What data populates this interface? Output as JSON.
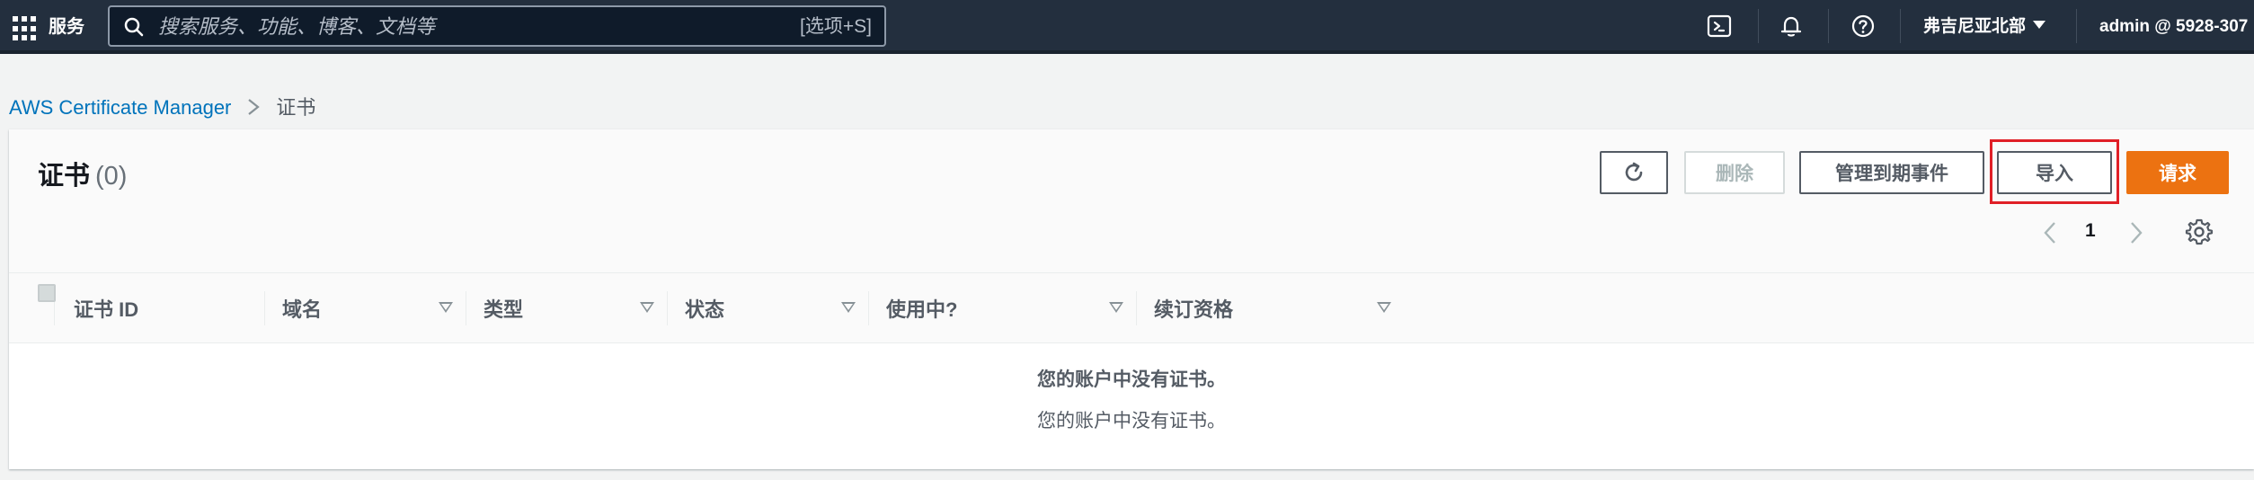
{
  "topnav": {
    "services_label": "服务",
    "search_placeholder": "搜索服务、功能、博客、文档等",
    "search_shortcut": "[选项+S]",
    "region": "弗吉尼亚北部",
    "account": "admin @ 5928-307"
  },
  "breadcrumb": {
    "root": "AWS Certificate Manager",
    "current": "证书"
  },
  "panel": {
    "title": "证书",
    "count": "(0)",
    "buttons": {
      "delete": "删除",
      "manage_expiry": "管理到期事件",
      "import": "导入",
      "request": "请求"
    },
    "page_number": "1"
  },
  "table": {
    "columns": [
      "证书 ID",
      "域名",
      "类型",
      "状态",
      "使用中?",
      "续订资格"
    ],
    "empty_title": "您的账户中没有证书。",
    "empty_message": "您的账户中没有证书。"
  },
  "colors": {
    "nav_bg": "#232f3e",
    "link": "#0073bb",
    "primary": "#ec7211",
    "highlight": "#e01f26"
  }
}
